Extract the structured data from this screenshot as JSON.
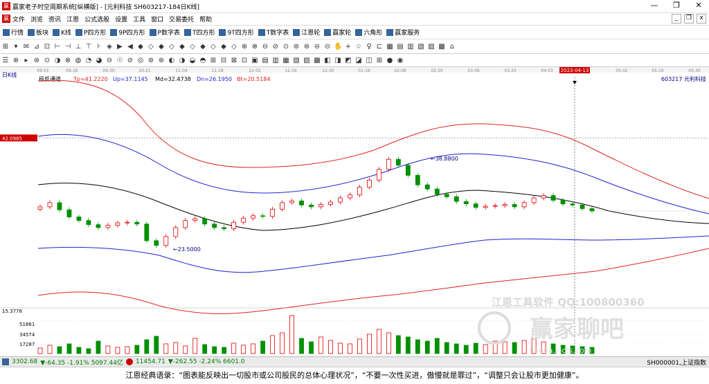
{
  "window": {
    "title": "赢家老子时空周期系统[纵横版] - [元利科技  SH603217-184日K线]",
    "minimize": "—",
    "restore": "❐",
    "close": "✕"
  },
  "menu": {
    "items": [
      "文件",
      "浏览",
      "资讯",
      "江恩",
      "公式选股",
      "设置",
      "工具",
      "窗口",
      "交易委托",
      "帮助"
    ],
    "mdi": [
      "_",
      "❐",
      "x"
    ]
  },
  "toolbar": {
    "items": [
      {
        "icon": "grid-icon",
        "label": "行情"
      },
      {
        "icon": "block-icon",
        "label": "板块"
      },
      {
        "icon": "kline-icon",
        "label": "K线"
      },
      {
        "icon": "p-square-icon",
        "label": "P四方形"
      },
      {
        "icon": "9p-square-icon",
        "label": "9P四方形"
      },
      {
        "icon": "p-number-icon",
        "label": "P数字表"
      },
      {
        "icon": "t-square-icon",
        "label": "T四方形"
      },
      {
        "icon": "9t-square-icon",
        "label": "9T四方形"
      },
      {
        "icon": "t-number-icon",
        "label": "T数字表"
      },
      {
        "icon": "gann-wheel-icon",
        "label": "江恩轮"
      },
      {
        "icon": "winner-wheel-icon",
        "label": "赢家轮"
      },
      {
        "icon": "hexagon-icon",
        "label": "六角形"
      },
      {
        "icon": "service-icon",
        "label": "赢家服务"
      }
    ]
  },
  "chart": {
    "period_label": "日K线",
    "indicator": {
      "name": "极反通道",
      "tp": "Tp=41.2220",
      "up": "Up=37.1145",
      "md": "Md=32.4738",
      "dn": "Dn=26.1950",
      "bt": "Bt=20.5184"
    },
    "stock_code_name": "603217  元利科技",
    "price_flag": "42.0985",
    "high_label": "38.8800",
    "low_label": "23.5000",
    "cursor_date": "2023-04-13",
    "date_ticks": [
      "09-01",
      "09-16",
      "09-30",
      "10-21",
      "11-04",
      "11-18",
      "12-02",
      "12-16",
      "12-30",
      "01-16",
      "02-06",
      "02-20",
      "03-06",
      "03-20",
      "04-03",
      "05-02",
      "05-16",
      "05-30"
    ],
    "volume_max_label": "15.3778",
    "volume_ticks": [
      "51861",
      "34574",
      "17287"
    ],
    "watermark1": "江恩工具软件  QQ:100800360",
    "watermark2": "赢家聊吧",
    "watermark3": "jiaoba.yjcts.com"
  },
  "chart_data": {
    "type": "candlestick",
    "title": "元利科技 603217 日K线",
    "indicator": "极反通道",
    "x_ticks": [
      "09-01",
      "09-16",
      "09-30",
      "10-21",
      "11-04",
      "11-18",
      "12-02",
      "12-16",
      "12-30",
      "01-16",
      "02-06",
      "02-20",
      "03-06",
      "03-20",
      "04-03",
      "04-13",
      "05-02",
      "05-16",
      "05-30"
    ],
    "ylim": [
      15,
      45
    ],
    "annotations": [
      {
        "label": "38.8800",
        "type": "high"
      },
      {
        "label": "23.5000",
        "type": "low"
      },
      {
        "label": "42.0985",
        "type": "price-flag"
      }
    ],
    "close_trend": [
      30.5,
      31.2,
      30.0,
      28.8,
      28.2,
      27.5,
      27.0,
      27.4,
      27.8,
      27.9,
      27.6,
      24.8,
      24.0,
      25.5,
      27.0,
      28.2,
      28.5,
      27.6,
      27.0,
      26.8,
      27.9,
      28.6,
      29.0,
      28.9,
      30.1,
      31.2,
      31.5,
      30.8,
      30.5,
      30.9,
      31.3,
      32.0,
      32.5,
      33.8,
      35.0,
      36.8,
      38.5,
      37.5,
      35.8,
      34.2,
      33.5,
      32.6,
      32.2,
      31.4,
      31.0,
      30.4,
      30.6,
      30.7,
      30.9,
      30.5,
      31.2,
      32.0,
      32.4,
      31.6,
      31.0,
      30.8,
      30.2,
      29.8
    ],
    "volume_range": [
      0,
      69148
    ]
  },
  "status": {
    "sh_value": "3302.68",
    "sh_change": "▼-64.35 -1.91% 5097.44亿",
    "sz_value": "11454.71",
    "sz_change": "▼-262.55 -2.24% 6601.0",
    "right": "SH000001,上证指数",
    "color_down": "#007a00"
  },
  "footer": {
    "quote": "江恩经典语录：“图表能反映出一切股市或公司股民的总体心理状况”，“不要一次性买进，傲慢就是罪过”，“调整只会让股市更加健康”。"
  },
  "colors": {
    "red_line": "#e02020",
    "blue_line": "#2020d0",
    "mid_line": "#000000",
    "up_candle": "#e00000",
    "down_candle": "#009000"
  }
}
